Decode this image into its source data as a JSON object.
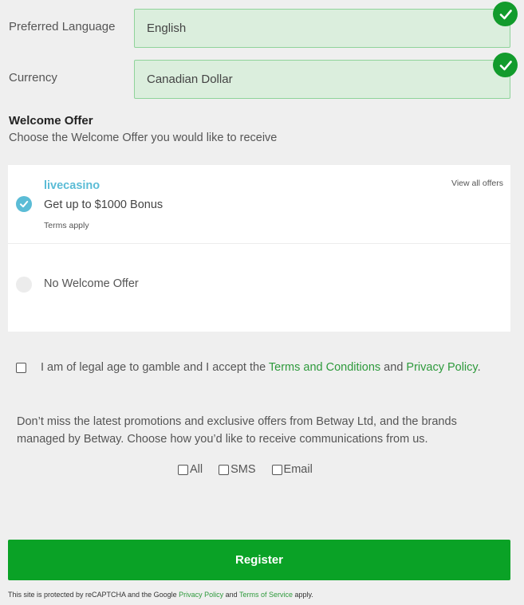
{
  "language": {
    "label": "Preferred Language",
    "value": "English"
  },
  "currency": {
    "label": "Currency",
    "value": "Canadian Dollar"
  },
  "welcome": {
    "title": "Welcome Offer",
    "subtitle": "Choose the Welcome Offer you would like to receive",
    "view_all": "View all offers",
    "offer": {
      "brand": "livecasino",
      "title": "Get up to $1000 Bonus",
      "terms": "Terms apply"
    },
    "none_label": "No Welcome Offer"
  },
  "legal": {
    "text_before": "I am of legal age to gamble and I accept the ",
    "terms_link": "Terms and Conditions",
    "and": " and ",
    "privacy_link": "Privacy Policy",
    "end": "."
  },
  "promo": {
    "text": "Don’t miss the latest promotions and exclusive offers from Betway Ltd, and the brands managed by Betway. Choose how you’d like to receive communications from us.",
    "options": [
      "All",
      "SMS",
      "Email"
    ]
  },
  "register_label": "Register",
  "recaptcha": {
    "before": "This site is protected by reCAPTCHA and the Google ",
    "privacy": "Privacy Policy",
    "and": " and ",
    "terms": "Terms of Service",
    "after": " apply."
  },
  "colors": {
    "accent_green": "#0aa226",
    "valid_green": "#129b2c",
    "offer_blue": "#5bbcd6",
    "link_green": "#2e9a3c"
  },
  "icons": {
    "valid": "check-circle-icon",
    "selected": "check-radio-icon"
  }
}
